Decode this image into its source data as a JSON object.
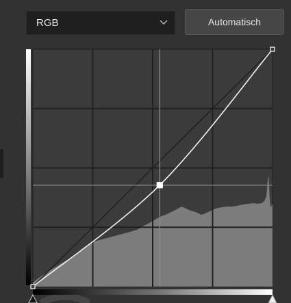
{
  "toolbar": {
    "channel_value": "RGB",
    "auto_label": "Automatisch"
  },
  "curve": {
    "input_range": [
      0,
      255
    ],
    "output_range": [
      0,
      255
    ],
    "points": [
      {
        "input": 0,
        "output": 0
      },
      {
        "input": 135,
        "output": 109
      },
      {
        "input": 255,
        "output": 255
      }
    ],
    "grid_divisions": 4,
    "colors": {
      "graph_background": "#3b3b3b",
      "histogram": "#7c7c7c",
      "grid": "#202020",
      "curve": "#f2f2f2"
    }
  },
  "icons": {
    "channel_dropdown": "chevron-down-icon",
    "black_point": "black-slider-triangle-icon",
    "white_point": "white-slider-triangle-icon"
  }
}
